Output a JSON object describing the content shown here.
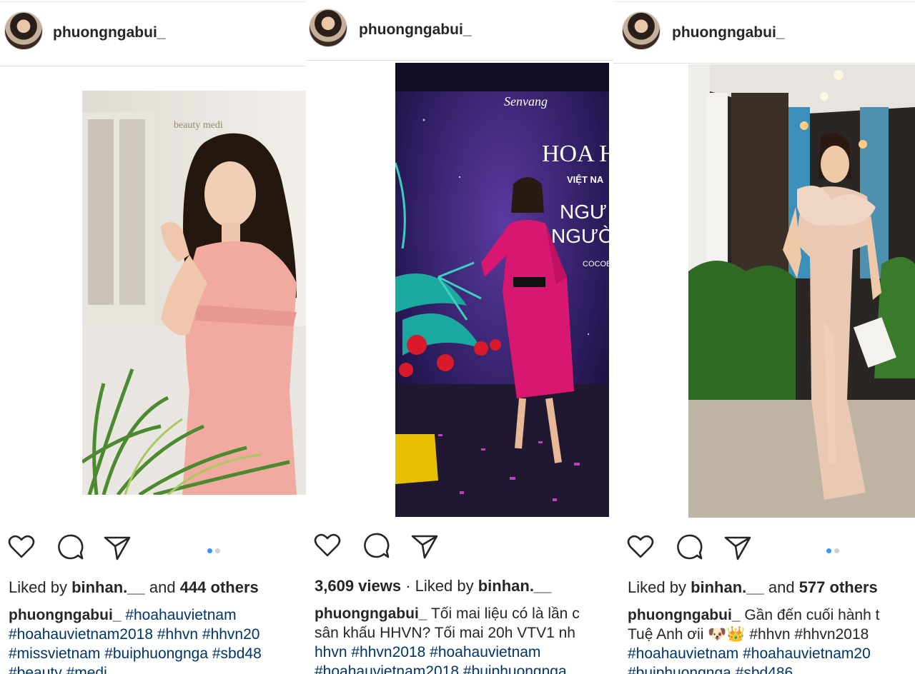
{
  "posts": [
    {
      "username": "phuongngabui_",
      "liked_prefix": "Liked by ",
      "liked_user": "binhan.__",
      "liked_mid": " and ",
      "liked_count": "444 others",
      "caption_user": "phuongngabui_",
      "caption_lines": [
        " #hoahauvietnam",
        "#hoahauvietnam2018 #hhvn #hhvn20",
        "#missvietnam #buiphuongnga #sbd48",
        "#beauty #medi"
      ],
      "photo_text": "beauty medi",
      "carousel": {
        "count": 2,
        "active": 1
      }
    },
    {
      "username": "phuongngabui_",
      "views": "3,609 views",
      "liked_prefix": " · Liked by ",
      "liked_user": "binhan.__",
      "caption_user": "phuongngabui_",
      "caption_lines": [
        " Tối mai liệu có là lần c",
        "sân khấu HHVN? Tối mai 20h VTV1 nh",
        "hhvn #hhvn2018 #hoahauvietnam",
        "#hoahauvietnam2018 #buiphuongnga"
      ],
      "stage_text": {
        "brand": "Senvang",
        "title": "HOA HẬ",
        "sub": "VIỆT NA",
        "line1": "NGƯ",
        "line2": "NGƯỜ",
        "venue": "COCOB"
      }
    },
    {
      "username": "phuongngabui_",
      "liked_prefix": "Liked by ",
      "liked_user": "binhan.__",
      "liked_mid": " and ",
      "liked_count": "577 others",
      "caption_user": "phuongngabui_",
      "caption_lines": [
        " Gần đến cuối hành t",
        "Tuệ Anh ơii 🐶👑 #hhvn #hhvn2018",
        "#hoahauvietnam #hoahauvietnam20",
        "#buiphuongnga #sbd486"
      ],
      "carousel": {
        "count": 2,
        "active": 1
      }
    }
  ],
  "icons": [
    "heart-icon",
    "comment-icon",
    "share-icon"
  ],
  "colors": {
    "hashtag": "#003569",
    "dot_active": "#3897f0",
    "dot_inactive": "#d0d0d0",
    "text": "#262626"
  }
}
